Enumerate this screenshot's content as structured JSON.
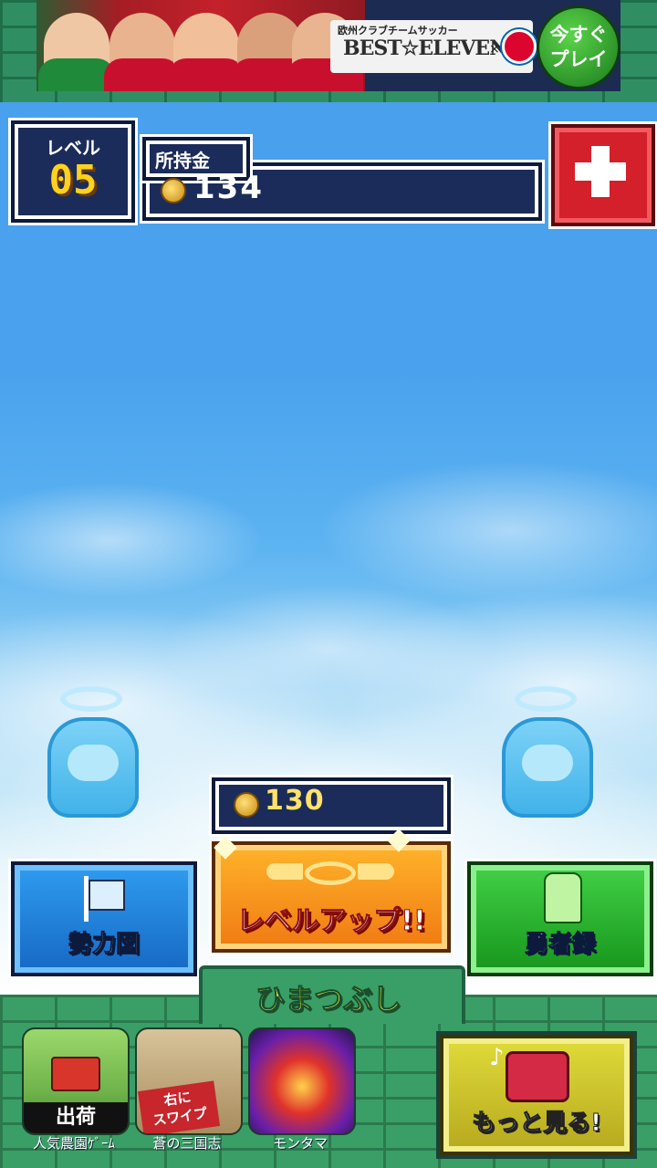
{
  "ad": {
    "subtitle": "欧州クラブチームサッカー",
    "title": "BEST☆ELEVEN",
    "times": "×",
    "play_label_line1": "今すぐ",
    "play_label_line2": "プレイ"
  },
  "status": {
    "level_label": "レベル",
    "level_value": "05",
    "gold_label": "所持金",
    "gold_value": "134"
  },
  "levelup": {
    "cost": "130",
    "label": "レベルアップ!!"
  },
  "buttons": {
    "territory": "勢力図",
    "heroes": "勇者録"
  },
  "footer": {
    "section_title": "ひまつぶし",
    "apps": [
      {
        "badge": "出荷",
        "caption": "人気農園ｹﾞｰﾑ"
      },
      {
        "badge": "右に\nスワイプ",
        "caption": "蒼の三国志"
      },
      {
        "caption": "モンタマ"
      }
    ],
    "more_label": "もっと見る!",
    "more_note": "♪"
  },
  "colors": {
    "sky": "#4aa2ee",
    "panel": "#1b2c5a",
    "gold": "#ffd21c",
    "levelup_orange": "#f07a12",
    "territory_blue": "#1668c4",
    "heroes_green": "#16951c",
    "add_red": "#d3202a",
    "section_yellow": "#f4ff3c"
  },
  "icons": [
    "coin-icon",
    "plus-icon",
    "flag-icon",
    "wings-icon",
    "knight-icon",
    "music-note-icon",
    "gift-box-icon",
    "ghost-statue"
  ]
}
